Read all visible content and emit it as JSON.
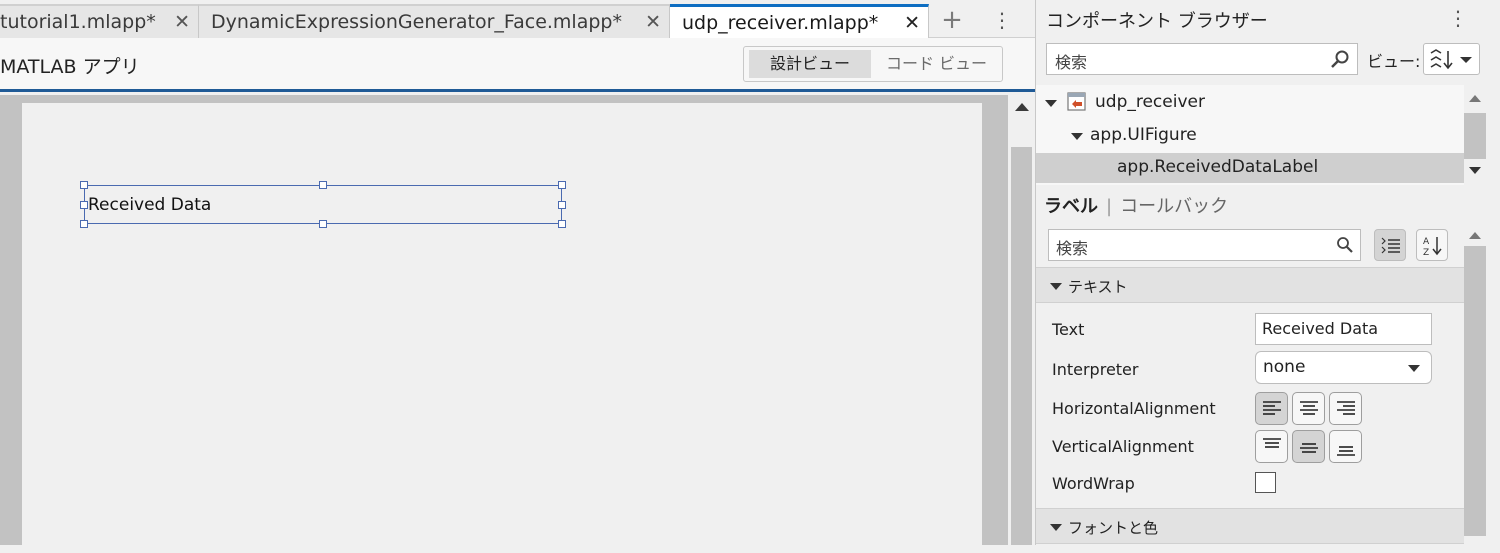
{
  "tabs": [
    {
      "label": "tutorial1.mlapp*",
      "close": "✕"
    },
    {
      "label": "DynamicExpressionGenerator_Face.mlapp*",
      "close": "✕"
    },
    {
      "label": "udp_receiver.mlapp*",
      "close": "✕"
    }
  ],
  "tabbar": {
    "plus": "+",
    "more": "⋮"
  },
  "toolbar": {
    "app_title": "MATLAB アプリ",
    "design_view": "設計ビュー",
    "code_view": "コード ビュー"
  },
  "canvas": {
    "label_text": "Received Data"
  },
  "component_browser": {
    "title": "コンポーネント ブラウザー",
    "more": "⋮",
    "search_placeholder": "検索",
    "view_label": "ビュー:",
    "tree": [
      {
        "label": "udp_receiver"
      },
      {
        "label": "app.UIFigure"
      },
      {
        "label": "app.ReceivedDataLabel"
      }
    ]
  },
  "inspector": {
    "tab_active": "ラベル",
    "tab_sep": "|",
    "tab_other": "コールバック",
    "search_placeholder": "検索",
    "section_text": "テキスト",
    "section_font": "フォントと色",
    "props": {
      "text_label": "Text",
      "text_value": "Received Data",
      "interpreter_label": "Interpreter",
      "interpreter_value": "none",
      "halign_label": "HorizontalAlignment",
      "valign_label": "VerticalAlignment",
      "wordwrap_label": "WordWrap"
    }
  }
}
